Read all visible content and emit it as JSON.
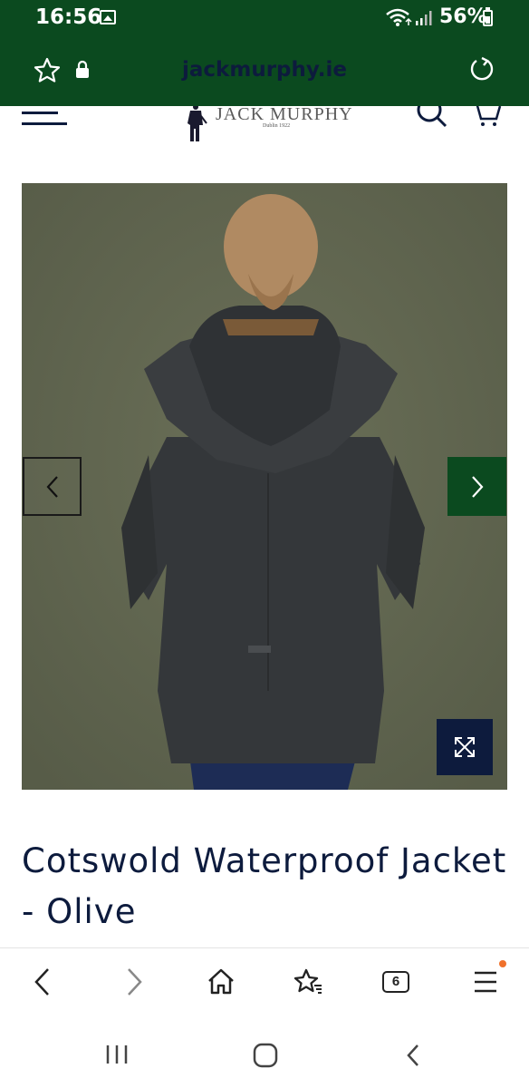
{
  "status_bar": {
    "time": "16:56",
    "battery": "56%",
    "icons": [
      "gallery-icon",
      "wifi-icon",
      "signal-icon",
      "battery-icon"
    ]
  },
  "browser": {
    "url": "jackmurphy.ie",
    "theme_color": "#0b4a1f",
    "tab_count": "6",
    "icons": [
      "star-icon",
      "lock-icon",
      "reload-icon",
      "back-icon",
      "forward-icon",
      "home-icon",
      "bookmarks-icon",
      "tabs-icon",
      "menu-icon"
    ]
  },
  "site": {
    "logo_text": "JACK MURPHY",
    "logo_subtext": "Dublin 1922",
    "header_icons": [
      "hamburger-icon",
      "search-icon",
      "cart-icon"
    ]
  },
  "product": {
    "image_alt": "Woman wearing olive waterproof jacket, back view",
    "title": "Cotswold Waterproof Jacket - Olive",
    "accent_color": "#0b4a1f",
    "navy_color": "#0d1b3d"
  }
}
